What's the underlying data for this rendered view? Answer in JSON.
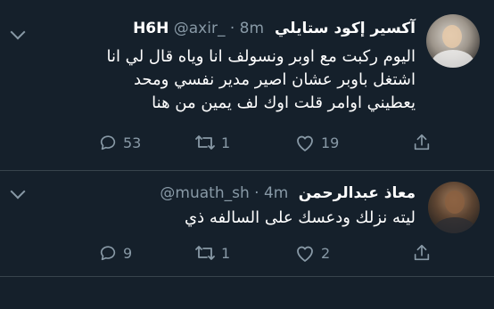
{
  "tweets": [
    {
      "display_name": "آكسير إكود ستايلي H6H",
      "handle_time": "@axir_ · 8m",
      "text_lines": [
        "اليوم ركبت مع اوبر ونسولف انا وياه قال لي انا",
        "اشتغل باوبر عشان اصير مدير نفسي ومحد",
        "يعطيني اوامر قلت اوك لف يمين من هنا"
      ],
      "replies": "53",
      "retweets": "1",
      "likes": "19"
    },
    {
      "display_name": "معاذ عبدالرحمن",
      "handle_time": "@muath_sh · 4m",
      "text_lines": [
        "ليته نزلك ودعسك على السالفه ذي"
      ],
      "replies": "9",
      "retweets": "1",
      "likes": "2"
    }
  ],
  "icons": {
    "reply": "reply-icon",
    "retweet": "retweet-icon",
    "like": "heart-icon",
    "share": "share-icon",
    "more": "chevron-down-icon"
  },
  "colors": {
    "background": "#15202b",
    "secondary_text": "#8899a6",
    "divider": "#38444d"
  }
}
